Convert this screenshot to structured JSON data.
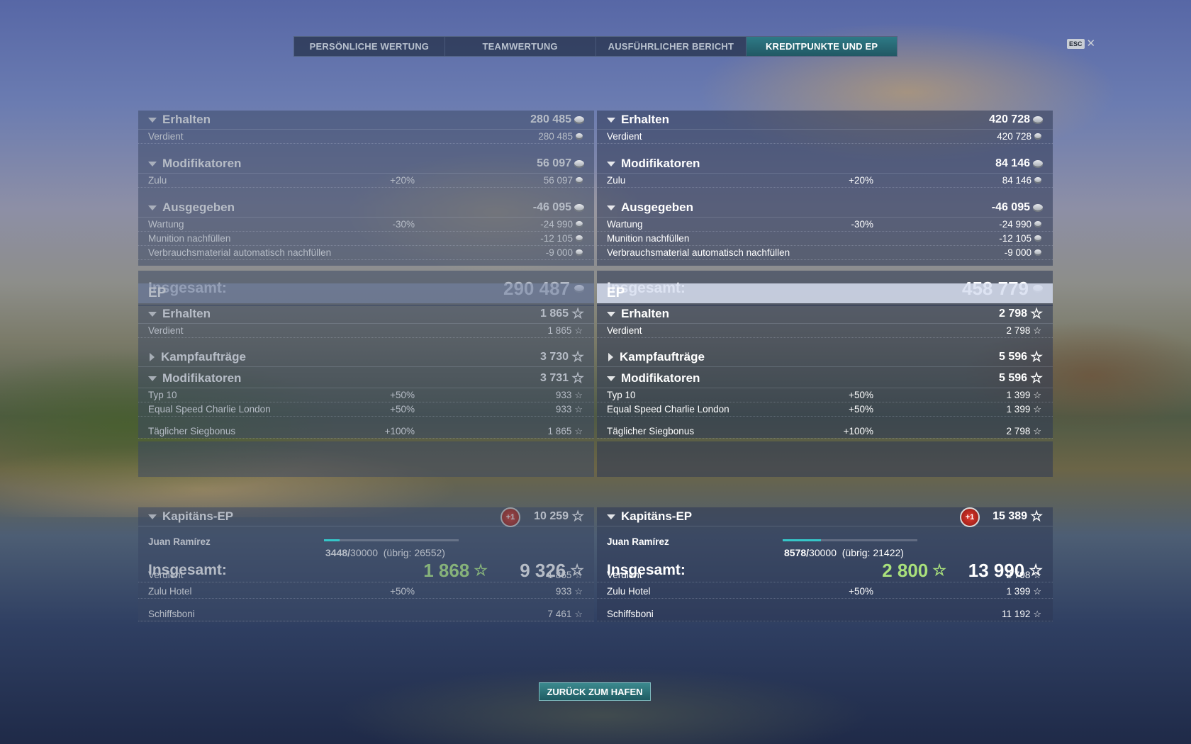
{
  "tabs": [
    "PERSÖNLICHE WERTUNG",
    "TEAMWERTUNG",
    "AUSFÜHRLICHER BERICHT",
    "KREDITPUNKTE UND EP"
  ],
  "active_tab": "KREDITPUNKTE UND EP",
  "esc_label": "ESC",
  "close_glyph": "✕",
  "star_glyph": "☆",
  "labels": {
    "erhalten": "Erhalten",
    "verdient": "Verdient",
    "modifikatoren": "Modifikatoren",
    "zulu": "Zulu",
    "ausgegeben": "Ausgegeben",
    "wartung": "Wartung",
    "munition": "Munition nachfüllen",
    "verbrauch": "Verbrauchsmaterial automatisch nachfüllen",
    "insgesamt": "Insgesamt:",
    "ep": "EP",
    "kampfauftraege": "Kampfaufträge",
    "typ10": "Typ 10",
    "escl": "Equal Speed Charlie London",
    "siegbonus": "Täglicher Siegbonus",
    "kapitaens_ep": "Kapitäns-EP",
    "zulu_hotel": "Zulu Hotel",
    "schiffsboni": "Schiffsboni",
    "badge": "+1",
    "uebrig_prefix": "(übrig: ",
    "uebrig_suffix": ")"
  },
  "left": {
    "credits": {
      "erhalten": "280 485",
      "verdient": "280 485",
      "modifikatoren": "56 097",
      "zulu_pct": "+20%",
      "zulu": "56 097",
      "ausgegeben": "-46 095",
      "wartung_pct": "-30%",
      "wartung": "-24 990",
      "munition": "-12 105",
      "verbrauch": "-9 000",
      "total": "290 487"
    },
    "ep": {
      "erhalten": "1 865",
      "verdient": "1 865",
      "kampfauftraege": "3 730",
      "modifikatoren": "3 731",
      "typ10_pct": "+50%",
      "typ10": "933",
      "escl_pct": "+50%",
      "escl": "933",
      "sieg_pct": "+100%",
      "sieg": "1 865",
      "total_green": "1 868",
      "total": "9 326"
    },
    "captain": {
      "total": "10 259",
      "name": "Juan Ramírez",
      "progress_current": "3448/",
      "progress_max": "30000",
      "remaining": "26552",
      "progress_fraction": 0.115,
      "verdient": "1 865",
      "zulu_hotel_pct": "+50%",
      "zulu_hotel": "933",
      "schiffsboni": "7 461"
    }
  },
  "right": {
    "credits": {
      "erhalten": "420 728",
      "verdient": "420 728",
      "modifikatoren": "84 146",
      "zulu_pct": "+20%",
      "zulu": "84 146",
      "ausgegeben": "-46 095",
      "wartung_pct": "-30%",
      "wartung": "-24 990",
      "munition": "-12 105",
      "verbrauch": "-9 000",
      "total": "458 779"
    },
    "ep": {
      "erhalten": "2 798",
      "verdient": "2 798",
      "kampfauftraege": "5 596",
      "modifikatoren": "5 596",
      "typ10_pct": "+50%",
      "typ10": "1 399",
      "escl_pct": "+50%",
      "escl": "1 399",
      "sieg_pct": "+100%",
      "sieg": "2 798",
      "total_green": "2 800",
      "total": "13 990"
    },
    "captain": {
      "total": "15 389",
      "name": "Juan Ramírez",
      "progress_current": "8578/",
      "progress_max": "30000",
      "remaining": "21422",
      "progress_fraction": 0.286,
      "verdient": "2 798",
      "zulu_hotel_pct": "+50%",
      "zulu_hotel": "1 399",
      "schiffsboni": "11 192"
    }
  },
  "back_button": "ZURÜCK ZUM HAFEN"
}
